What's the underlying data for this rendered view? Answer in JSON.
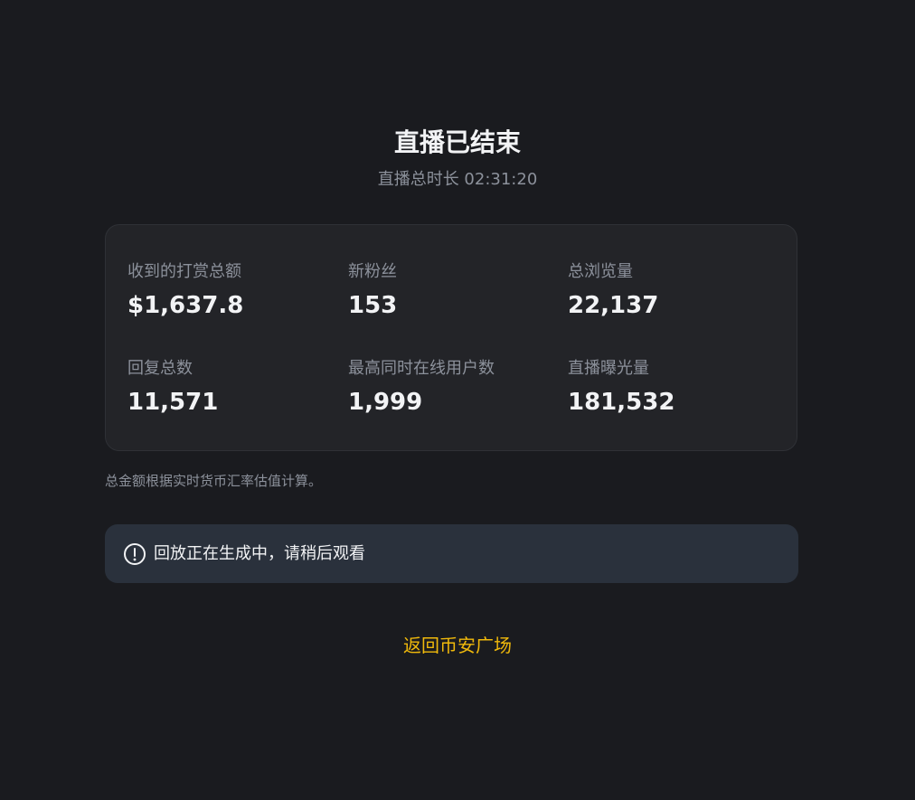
{
  "header": {
    "title": "直播已结束",
    "duration": "直播总时长 02:31:20"
  },
  "stats": [
    {
      "label": "收到的打赏总额",
      "value": "$1,637.8"
    },
    {
      "label": "新粉丝",
      "value": "153"
    },
    {
      "label": "总浏览量",
      "value": "22,137"
    },
    {
      "label": "回复总数",
      "value": "11,571"
    },
    {
      "label": "最高同时在线用户数",
      "value": "1,999"
    },
    {
      "label": "直播曝光量",
      "value": "181,532"
    }
  ],
  "note": "总金额根据实时货币汇率估值计算。",
  "replay_banner": {
    "icon": "info-icon",
    "text": "回放正在生成中，请稍后观看"
  },
  "back_link": {
    "label": "返回币安广场"
  },
  "colors": {
    "background": "#1a1b1f",
    "card": "#232428",
    "banner": "#2a313c",
    "accent": "#f0b90b",
    "muted_text": "#8c919b"
  }
}
